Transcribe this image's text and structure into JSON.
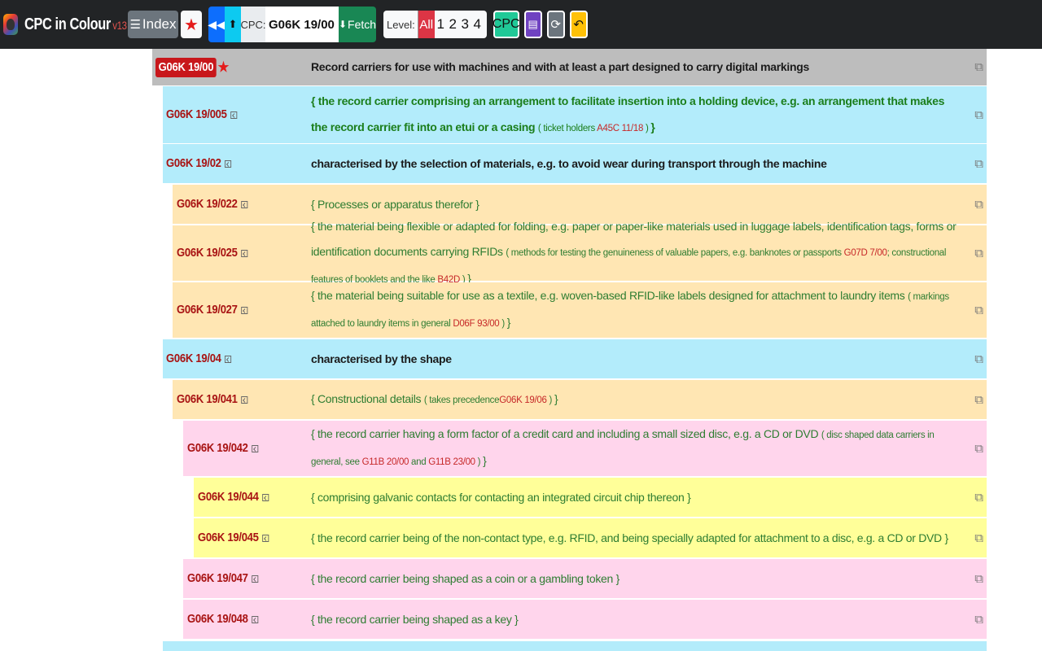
{
  "app": {
    "brand": "CPC in Colour",
    "version": "v13"
  },
  "toolbar": {
    "index_label": "Index",
    "index_icon": "list-icon",
    "star_icon": "star-icon",
    "back_icon": "double-chevron-left-icon",
    "up_icon": "arrow-up-circle-icon",
    "cpc_label": "CPC:",
    "cpc_value": "G06K 19/00",
    "fetch_label": "Fetch",
    "fetch_icon": "download-icon",
    "level_label": "Level:",
    "level_all": "All",
    "levels": [
      "1",
      "2",
      "3",
      "4"
    ],
    "cpc_button": "CPC",
    "book_icon": "book-icon",
    "refresh_icon": "refresh-icon",
    "undo_icon": "undo-icon"
  },
  "colors": {
    "header": "#bdbdbd",
    "level1": "#b3ecfb",
    "level2": "#ffe6b3",
    "level3": "#ffd5ec",
    "level4": "#ffff99"
  },
  "header_row": {
    "code": "G06K 19/00",
    "title": "Record carriers for use with machines and with at least a part designed to carry digital markings"
  },
  "rows": [
    {
      "code": "G06K 19/005",
      "level": 1,
      "title": "{ the record carrier comprising an arrangement to facilitate insertion into a holding device, e.g. an arrangement that makes the record carrier fit into an etui or a casing",
      "note": "ticket holders",
      "ref": "A45C 11/18",
      "tail": "}"
    },
    {
      "code": "G06K 19/02",
      "level": 1,
      "title": "characterised by the selection of materials, e.g. to avoid wear during transport through the machine"
    },
    {
      "code": "G06K 19/022",
      "level": 2,
      "title": "{ Processes or apparatus therefor }"
    },
    {
      "code": "G06K 19/025",
      "level": 2,
      "title": "{ the material being flexible or adapted for folding, e.g. paper or paper-like materials used in luggage labels, identification tags, forms or identification documents carrying RFIDs",
      "note": "methods for testing the genuineness of valuable papers, e.g. banknotes or passports",
      "ref": "G07D 7/00",
      "note2": "; constructional features of booklets and the like",
      "ref2": "B42D",
      "tail": "}"
    },
    {
      "code": "G06K 19/027",
      "level": 2,
      "title": "{ the material being suitable for use as a textile, e.g. woven-based RFID-like labels designed for attachment to laundry items",
      "note": "markings attached to laundry items in general",
      "ref": "D06F 93/00",
      "tail": "}"
    },
    {
      "code": "G06K 19/04",
      "level": 1,
      "title": "characterised by the shape"
    },
    {
      "code": "G06K 19/041",
      "level": 2,
      "title": "{ Constructional details",
      "note": "takes precedence",
      "ref": "G06K 19/06",
      "tail": "}"
    },
    {
      "code": "G06K 19/042",
      "level": 3,
      "title": "{ the record carrier having a form factor of a credit card and including a small sized disc, e.g. a CD or DVD",
      "note": "disc shaped data carriers in general, see",
      "ref": "G11B 20/00",
      "note2": "and",
      "ref2": "G11B 23/00",
      "tail": "}"
    },
    {
      "code": "G06K 19/044",
      "level": 4,
      "title": "{ comprising galvanic contacts for contacting an integrated circuit chip thereon }"
    },
    {
      "code": "G06K 19/045",
      "level": 4,
      "title": "{ the record carrier being of the non-contact type, e.g. RFID, and being specially adapted for attachment to a disc, e.g. a CD or DVD }"
    },
    {
      "code": "G06K 19/047",
      "level": 3,
      "title": "{ the record carrier being shaped as a coin or a gambling token }"
    },
    {
      "code": "G06K 19/048",
      "level": 3,
      "title": "{ the record carrier being shaped as a key }"
    }
  ]
}
